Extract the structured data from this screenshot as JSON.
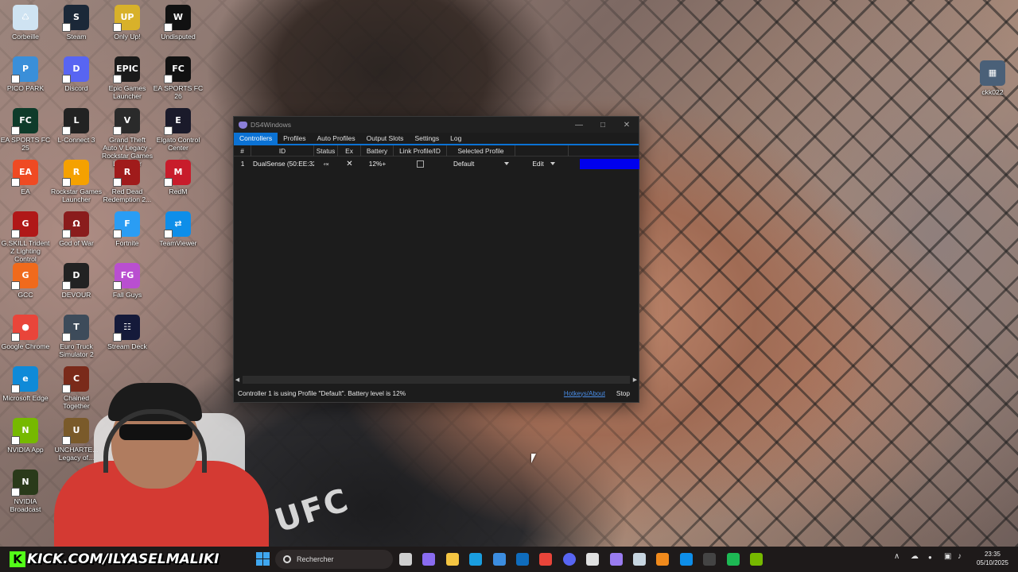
{
  "desktop": {
    "icons": [
      {
        "label": "Corbeille",
        "glyph": "♺",
        "color": "#cfe3f2"
      },
      {
        "label": "Steam",
        "glyph": "S",
        "color": "#1b2838"
      },
      {
        "label": "Only Up!",
        "glyph": "UP",
        "color": "#d8b12a"
      },
      {
        "label": "Undisputed",
        "glyph": "W",
        "color": "#111111"
      },
      {
        "label": "PICO PARK",
        "glyph": "P",
        "color": "#3a8fd9"
      },
      {
        "label": "Discord",
        "glyph": "D",
        "color": "#5865f2"
      },
      {
        "label": "Epic Games Launcher",
        "glyph": "EPIC",
        "color": "#1a1a1a"
      },
      {
        "label": "EA SPORTS FC 26",
        "glyph": "FC",
        "color": "#111111"
      },
      {
        "label": "EA SPORTS FC 25",
        "glyph": "FC",
        "color": "#0e3b2a"
      },
      {
        "label": "L-Connect 3",
        "glyph": "L",
        "color": "#222222"
      },
      {
        "label": "Grand Theft Auto V Legacy - Rockstar Games Launcher",
        "glyph": "V",
        "color": "#2a2a2a"
      },
      {
        "label": "Elgato Control Center",
        "glyph": "E",
        "color": "#1a1a2a"
      },
      {
        "label": "EA",
        "glyph": "EA",
        "color": "#ef4a23"
      },
      {
        "label": "Rockstar Games Launcher",
        "glyph": "R",
        "color": "#f5a100"
      },
      {
        "label": "Red Dead Redemption 2...",
        "glyph": "R",
        "color": "#a01b1b"
      },
      {
        "label": "RedM",
        "glyph": "M",
        "color": "#c81c2b"
      },
      {
        "label": "G.SKILL Trident Z Lighting Control",
        "glyph": "G",
        "color": "#b01818"
      },
      {
        "label": "God of War",
        "glyph": "Ω",
        "color": "#8a1c1c"
      },
      {
        "label": "Fortnite",
        "glyph": "F",
        "color": "#2a9df4"
      },
      {
        "label": "TeamViewer",
        "glyph": "⇄",
        "color": "#0e8ee9"
      },
      {
        "label": "GCC",
        "glyph": "G",
        "color": "#f06a1c"
      },
      {
        "label": "DEVOUR",
        "glyph": "D",
        "color": "#222222"
      },
      {
        "label": "Fall Guys",
        "glyph": "FG",
        "color": "#b94fd0"
      },
      {
        "label": "Google Chrome",
        "glyph": "●",
        "color": "#e9453a"
      },
      {
        "label": "Euro Truck Simulator 2",
        "glyph": "T",
        "color": "#3d4b5a"
      },
      {
        "label": "Stream Deck",
        "glyph": "☷",
        "color": "#151a3a"
      },
      {
        "label": "Microsoft Edge",
        "glyph": "e",
        "color": "#0f8ad8"
      },
      {
        "label": "Chained Together",
        "glyph": "C",
        "color": "#7a2a1a"
      },
      {
        "label": "NVIDIA App",
        "glyph": "N",
        "color": "#76b900"
      },
      {
        "label": "UNCHARTE... Legacy of...",
        "glyph": "U",
        "color": "#7a5a2a"
      },
      {
        "label": "NVIDIA Broadcast",
        "glyph": "N",
        "color": "#2a3a1a"
      },
      {
        "label": "ckk022",
        "glyph": "▦",
        "color": "#4a6078"
      }
    ]
  },
  "window": {
    "title": "DS4Windows",
    "controls": {
      "minimize": "—",
      "maximize": "□",
      "close": "✕"
    },
    "tabs": [
      "Controllers",
      "Profiles",
      "Auto Profiles",
      "Output Slots",
      "Settings",
      "Log"
    ],
    "active_tab": "Controllers",
    "columns": [
      "#",
      "ID",
      "Status",
      "Ex",
      "Battery",
      "Link Profile/ID",
      "Selected Profile"
    ],
    "controllers": [
      {
        "num": "1",
        "id": "DualSense (50:EE:32:",
        "status_icon": "usb-icon",
        "status_glyph": "⬾",
        "ex_glyph": "✕",
        "battery": "12%+",
        "linked": false,
        "profile": "Default",
        "edit_label": "Edit",
        "lightbar_color": "#0000ee"
      }
    ],
    "status_message": "Controller 1 is using Profile \"Default\". Battery level is 12%",
    "hotkeys_link": "Hotkeys/About",
    "stop_label": "Stop"
  },
  "overlay": {
    "kick_text": "KICK.COM/ILYASELMALIKI",
    "kick_logo": "K",
    "shorts_logo": "UFC"
  },
  "taskbar": {
    "search_placeholder": "Rechercher",
    "pinned": [
      {
        "name": "task-view-icon",
        "color": "#cfcfcf"
      },
      {
        "name": "copilot-icon",
        "color": "#8a6cf0"
      },
      {
        "name": "file-explorer-icon",
        "color": "#f5c542"
      },
      {
        "name": "edge-icon",
        "color": "#1a9ee0"
      },
      {
        "name": "store-icon",
        "color": "#3c8de0"
      },
      {
        "name": "outlook-icon",
        "color": "#0f6cbd"
      },
      {
        "name": "chrome-icon",
        "color": "#e9453a"
      },
      {
        "name": "discord-icon",
        "color": "#5865f2"
      },
      {
        "name": "mail-icon",
        "color": "#e0e0e0"
      },
      {
        "name": "game-controller-icon",
        "color": "#9a7cf0"
      },
      {
        "name": "steam-icon",
        "color": "#c7d5e0"
      },
      {
        "name": "vlc-icon",
        "color": "#f08a1c"
      },
      {
        "name": "teamviewer-icon",
        "color": "#0e8ee9"
      },
      {
        "name": "nvidia-icon",
        "color": "#444444"
      },
      {
        "name": "spotify-icon",
        "color": "#1db954"
      },
      {
        "name": "broadcast-icon",
        "color": "#76b900"
      }
    ],
    "tray": {
      "chevron": "∧",
      "cloud": "☁",
      "mic": "●",
      "network": "▣",
      "speaker": "♪"
    },
    "time": "23:35",
    "date": "05/10/2025"
  }
}
